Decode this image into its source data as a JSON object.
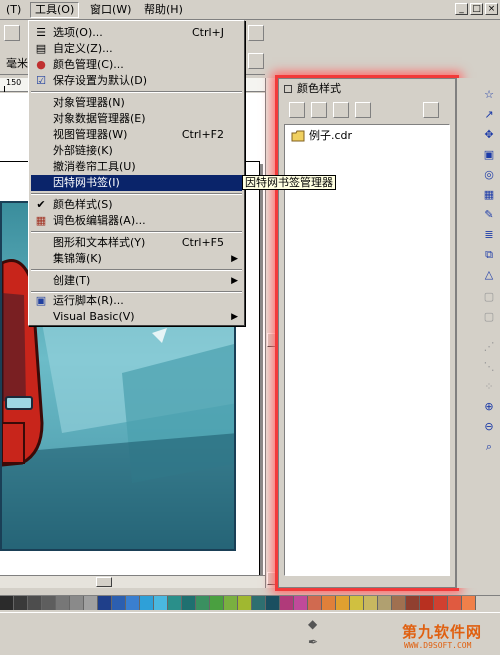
{
  "menubar": {
    "items": [
      "(T)",
      "工具(O)",
      "窗口(W)",
      "帮助(H)"
    ],
    "window_buttons": [
      "_",
      "□",
      "×"
    ]
  },
  "toolbar": {
    "unit_label": "毫米"
  },
  "ruler": {
    "label": "150"
  },
  "tools_menu": {
    "items": [
      {
        "label": "选项(O)...",
        "shortcut": "Ctrl+J"
      },
      {
        "label": "自定义(Z)..."
      },
      {
        "label": "颜色管理(C)..."
      },
      {
        "label": "保存设置为默认(D)"
      },
      {
        "label": "对象管理器(N)"
      },
      {
        "label": "对象数据管理器(E)"
      },
      {
        "label": "视图管理器(W)",
        "shortcut": "Ctrl+F2"
      },
      {
        "label": "外部链接(K)"
      },
      {
        "label": "撤消卷帘工具(U)"
      },
      {
        "label": "因特网书签(I)"
      },
      {
        "label": "颜色样式(S)"
      },
      {
        "label": "调色板编辑器(A)..."
      },
      {
        "label": "图形和文本样式(Y)",
        "shortcut": "Ctrl+F5"
      },
      {
        "label": "集锦簿(K)"
      },
      {
        "label": "创建(T)"
      },
      {
        "label": "运行脚本(R)..."
      },
      {
        "label": "Visual Basic(V)"
      }
    ],
    "highlighted_index": 9,
    "checked_item": "颜色样式(S)"
  },
  "tooltip": "因特网书签管理器",
  "docker": {
    "title": "颜色样式",
    "file_item": "例子.cdr"
  },
  "watermark": {
    "title": "第九软件网",
    "url": "WWW.D9SOFT.COM"
  },
  "colors": {
    "menu_bg": "#d4d0c8",
    "highlight": "#0a246a",
    "tooltip_bg": "#ffffe1",
    "docker_glow": "#f23a3a",
    "palette": [
      "#2b2b2b",
      "#3a3a3a",
      "#4d4d4d",
      "#5e5e5e",
      "#777777",
      "#8a8a8a",
      "#a0a0a0",
      "#1f3f8a",
      "#2c5fb0",
      "#3a7fd0",
      "#2ea0d8",
      "#4ab8e0",
      "#2a8f8a",
      "#1f7070",
      "#3a9060",
      "#4aa040",
      "#7ab040",
      "#a0b830",
      "#2e6f70",
      "#1a4f60",
      "#b03a7a",
      "#c04a9a",
      "#d06a50",
      "#e0803a",
      "#e0a030",
      "#d0c040",
      "#c8b860",
      "#b0a070",
      "#a07050",
      "#904030",
      "#b83020",
      "#d04030",
      "#e05a40",
      "#f0804a"
    ]
  }
}
